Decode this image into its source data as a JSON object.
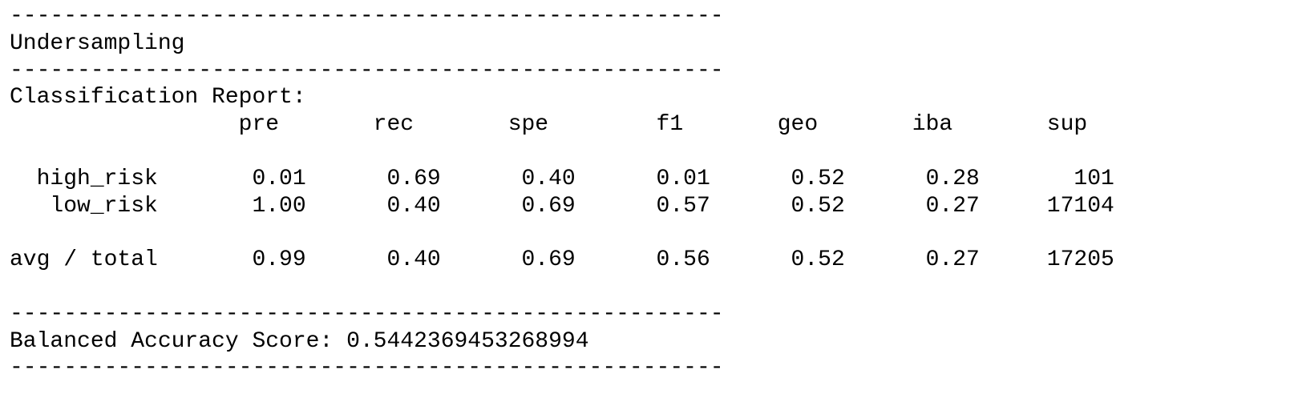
{
  "output": {
    "separator": "-----------------------------------------------------",
    "section_title": "Undersampling",
    "report_heading": "Classification Report:",
    "header_row": "                 pre       rec       spe        f1       geo       iba       sup",
    "rows": [
      "  high_risk       0.01      0.69      0.40      0.01      0.52      0.28       101",
      "   low_risk       1.00      0.40      0.69      0.57      0.52      0.27     17104",
      "avg / total       0.99      0.40      0.69      0.56      0.52      0.27     17205"
    ],
    "balanced_accuracy": "Balanced Accuracy Score: 0.5442369453268994"
  }
}
